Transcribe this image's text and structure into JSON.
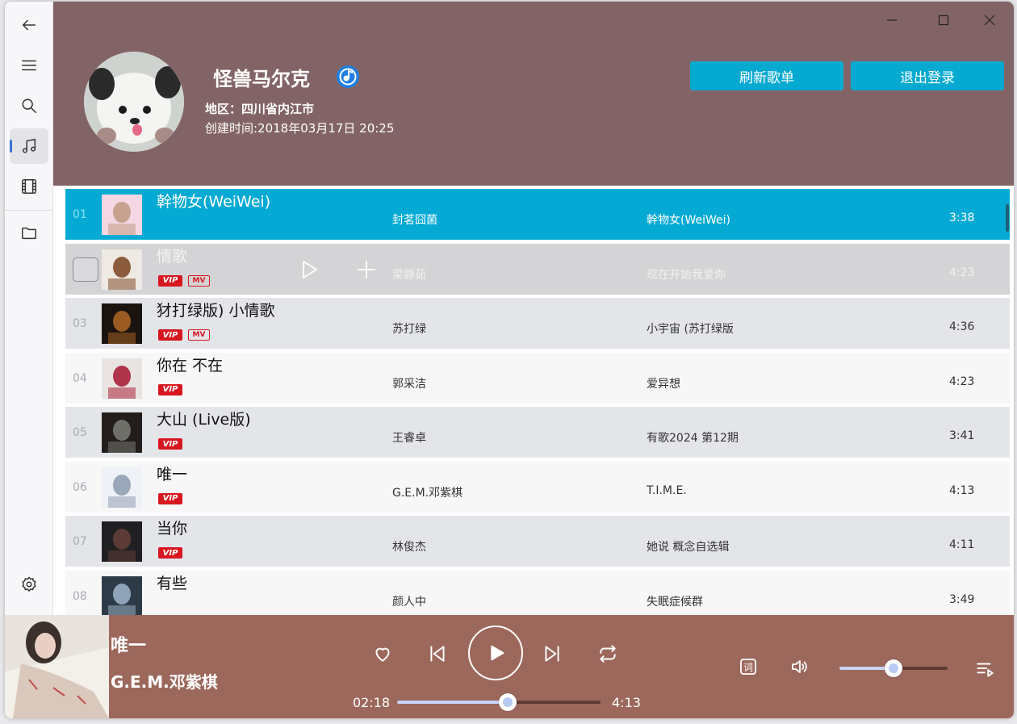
{
  "window": {
    "controls": [
      "minimize",
      "maximize",
      "close"
    ]
  },
  "sidebar": {
    "items": [
      {
        "name": "back",
        "icon": "back-arrow-icon"
      },
      {
        "name": "menu",
        "icon": "menu-icon"
      },
      {
        "name": "search",
        "icon": "search-icon"
      },
      {
        "name": "music",
        "icon": "music-note-icon",
        "active": true
      },
      {
        "name": "video",
        "icon": "film-icon"
      },
      {
        "name": "folder",
        "icon": "folder-icon"
      },
      {
        "name": "settings",
        "icon": "gear-icon"
      }
    ]
  },
  "profile": {
    "username": "怪兽马尔克",
    "region": "地区：四川省内江市",
    "created": "创建时间:2018年03月17日 20:25",
    "refresh_label": "刷新歌单",
    "logout_label": "退出登录",
    "verified_icon": "music-badge-icon"
  },
  "songs": [
    {
      "index": "01",
      "title": "幹物女(WeiWei)",
      "artist": "封茗囧菌",
      "album": "幹物女(WeiWei)",
      "duration": "3:38",
      "vip": false,
      "mv": false,
      "state": "selected"
    },
    {
      "index": "02",
      "title": "情歌",
      "artist": "梁静茹",
      "album": "现在开始我爱你",
      "duration": "4:23",
      "vip": true,
      "mv": true,
      "state": "hover"
    },
    {
      "index": "03",
      "title": "犲打绿版) 小情歌",
      "artist": "苏打绿",
      "album": "小宇宙 (苏打绿版",
      "duration": "4:36",
      "vip": true,
      "mv": true,
      "state": "normal"
    },
    {
      "index": "04",
      "title": "你在 不在",
      "artist": "郭采洁",
      "album": "爱异想",
      "duration": "4:23",
      "vip": true,
      "mv": false,
      "state": "normal"
    },
    {
      "index": "05",
      "title": "大山 (Live版)",
      "artist": "王睿卓",
      "album": "有歌2024 第12期",
      "duration": "3:41",
      "vip": true,
      "mv": false,
      "state": "normal"
    },
    {
      "index": "06",
      "title": "唯一",
      "artist": "G.E.M.邓紫棋",
      "album": "T.I.M.E.",
      "duration": "4:13",
      "vip": true,
      "mv": false,
      "state": "normal"
    },
    {
      "index": "07",
      "title": "当你",
      "artist": "林俊杰",
      "album": "她说 概念自选辑",
      "duration": "4:11",
      "vip": true,
      "mv": false,
      "state": "normal"
    },
    {
      "index": "08",
      "title": "有些",
      "artist": "颜人中",
      "album": "失眠症候群",
      "duration": "3:49",
      "vip": false,
      "mv": false,
      "state": "normal"
    }
  ],
  "tag_labels": {
    "vip": "VIP",
    "mv": "MV"
  },
  "player": {
    "title": "唯一",
    "artist": "G.E.M.邓紫棋",
    "elapsed": "02:18",
    "total": "4:13",
    "progress": 0.545,
    "volume": 0.5,
    "lyrics_label": "词",
    "colors": {
      "bar": "#9d685c",
      "accent": "#c7d4f6"
    }
  },
  "colors": {
    "header": "#836466",
    "selected_row": "#04aad4",
    "button": "#06a9cf",
    "vip_red": "#d7171f"
  }
}
